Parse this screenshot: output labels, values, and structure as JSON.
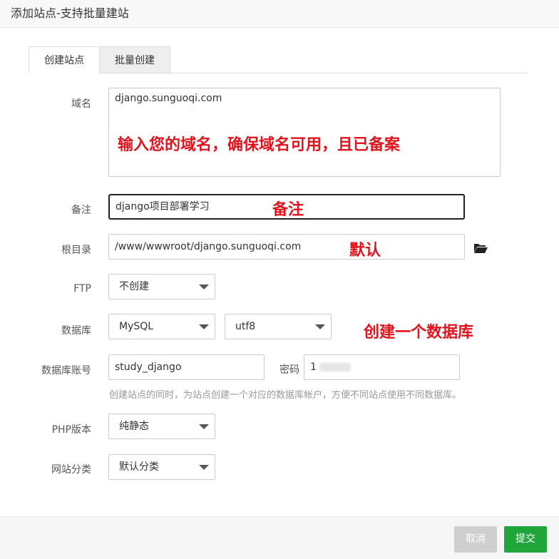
{
  "dialog": {
    "title": "添加站点-支持批量建站"
  },
  "tabs": [
    {
      "label": "创建站点",
      "active": true
    },
    {
      "label": "批量创建",
      "active": false
    }
  ],
  "form": {
    "domain": {
      "label": "域名",
      "value": "django.sunguoqi.com"
    },
    "remark": {
      "label": "备注",
      "value": "django项目部署学习"
    },
    "root_dir": {
      "label": "根目录",
      "value": "/www/wwwroot/django.sunguoqi.com"
    },
    "ftp": {
      "label": "FTP",
      "selected": "不创建"
    },
    "database": {
      "label": "数据库",
      "type_selected": "MySQL",
      "charset_selected": "utf8"
    },
    "db_account": {
      "label": "数据库账号",
      "value": "study_django",
      "password_label": "密码",
      "password_value": "1"
    },
    "db_help": "创建站点的同时，为站点创建一个对应的数据库帐户，方便不同站点使用不同数据库。",
    "php_version": {
      "label": "PHP版本",
      "selected": "纯静态"
    },
    "site_category": {
      "label": "网站分类",
      "selected": "默认分类"
    }
  },
  "annotations": {
    "domain_note": "输入您的域名，确保域名可用，且已备案",
    "remark_note": "备注",
    "root_note": "默认",
    "db_note": "创建一个数据库",
    "color": "#e0141c"
  },
  "buttons": {
    "cancel": "取消",
    "submit": "提交"
  },
  "colors": {
    "submit": "#20a53a",
    "cancel": "#cfcfcf"
  },
  "icons": {
    "folder": "folder-open-icon"
  }
}
